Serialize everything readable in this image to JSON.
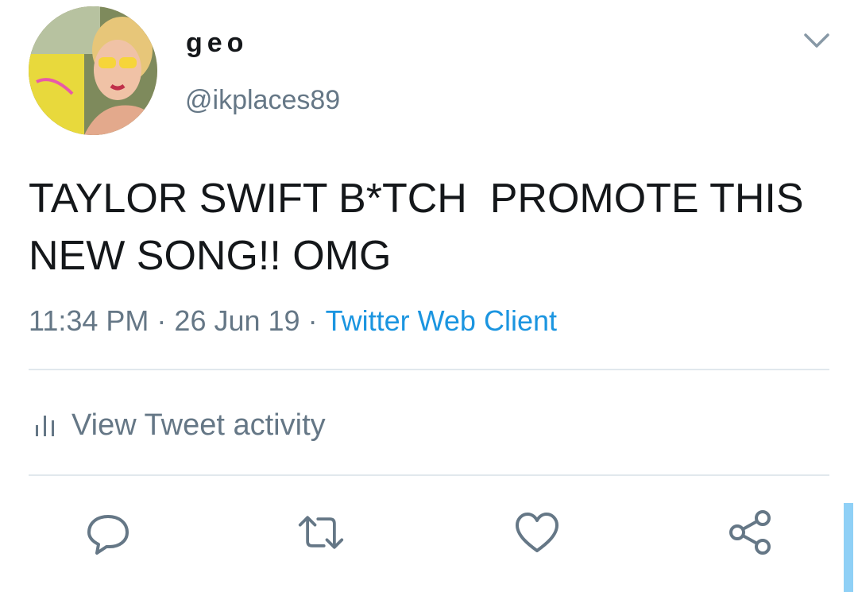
{
  "author": {
    "display_name": "geo",
    "handle": "@ikplaces89",
    "avatar_icon": "profile-photo"
  },
  "tweet": {
    "text": "TAYLOR SWIFT B*TCH  PROMOTE THIS NEW SONG!! OMG",
    "time": "11:34 PM",
    "date": "26 Jun 19",
    "source": "Twitter Web Client",
    "separator": "·"
  },
  "activity": {
    "label": "View Tweet activity",
    "icon": "bar-chart-icon"
  },
  "actions": [
    {
      "name": "reply",
      "icon": "speech-bubble-icon"
    },
    {
      "name": "retweet",
      "icon": "retweet-arrows-icon"
    },
    {
      "name": "like",
      "icon": "heart-icon"
    },
    {
      "name": "share",
      "icon": "share-nodes-icon"
    }
  ],
  "colors": {
    "text_primary": "#14171a",
    "text_secondary": "#657786",
    "link": "#1b95e0",
    "divider": "#e1e8ed",
    "scrollbar": "#8fd0f6"
  }
}
